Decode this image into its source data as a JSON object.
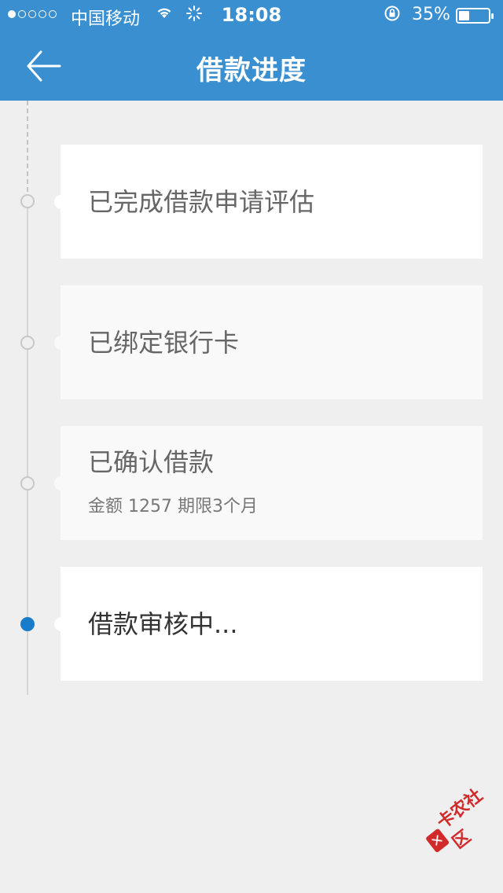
{
  "status_bar": {
    "carrier": "中国移动",
    "time": "18:08",
    "battery": "35%",
    "battery_level": 0.35,
    "signal_filled": 1,
    "signal_total": 5
  },
  "header": {
    "title": "借款进度",
    "back_icon": "arrow-left-icon"
  },
  "steps": [
    {
      "label": "已完成借款申请评估",
      "detail": "",
      "state": "done"
    },
    {
      "label": "已绑定银行卡",
      "detail": "",
      "state": "done"
    },
    {
      "label": "已确认借款",
      "detail": "金额 1257  期限3个月",
      "state": "done"
    },
    {
      "label": "借款审核中...",
      "detail": "",
      "state": "current"
    }
  ],
  "watermark": {
    "text": "卡农社区"
  },
  "colors": {
    "header_bg": "#3a8fd0",
    "active_node": "#1a7cc9",
    "page_bg": "#efefef"
  }
}
